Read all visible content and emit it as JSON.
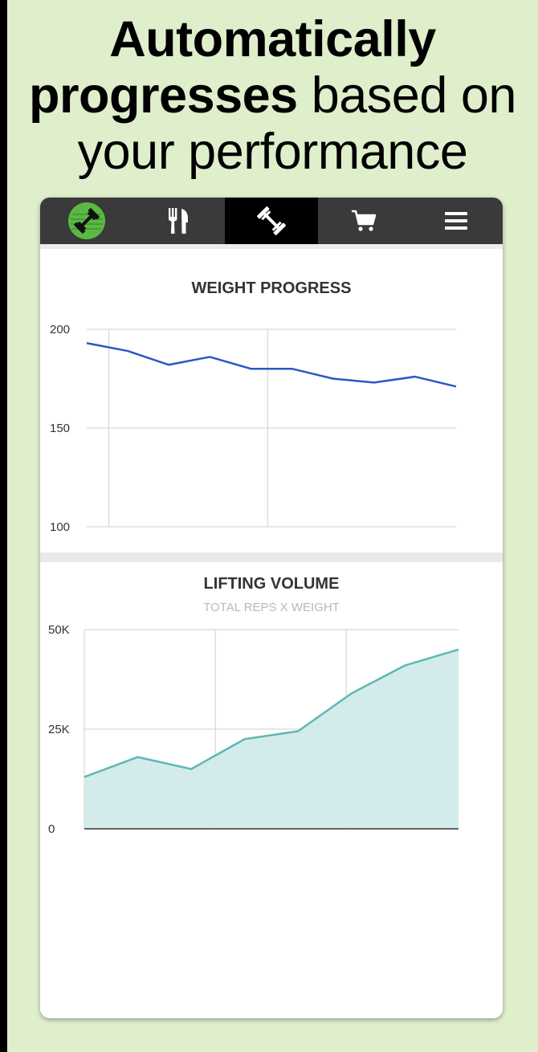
{
  "headline": {
    "line1_bold": "Automatically",
    "line2_bold": "progresses",
    "line2_regular": " based on",
    "line3_regular": "your performance"
  },
  "nav": {
    "items": [
      {
        "icon": "app-logo-icon",
        "active": false
      },
      {
        "icon": "fork-knife-icon",
        "active": false
      },
      {
        "icon": "dumbbell-icon",
        "active": true
      },
      {
        "icon": "cart-icon",
        "active": false
      },
      {
        "icon": "menu-icon",
        "active": false
      }
    ]
  },
  "colors": {
    "page_background": "#dfeecb",
    "nav_background": "#3a3a3a",
    "nav_active": "#000000",
    "logo_green": "#5cb844",
    "weight_line": "#2a58c7",
    "volume_line": "#5fb7b5",
    "volume_fill": "#d1ebea"
  },
  "chart_data": [
    {
      "type": "line",
      "title": "WEIGHT PROGRESS",
      "subtitle": "",
      "xlabel": "",
      "ylabel": "",
      "ylim": [
        100,
        200
      ],
      "yticks": [
        "200",
        "150",
        "100"
      ],
      "grid": true,
      "x": [
        0,
        1,
        2,
        3,
        4,
        5,
        6,
        7,
        8,
        9
      ],
      "series": [
        {
          "values": [
            193,
            189,
            182,
            186,
            180,
            180,
            175,
            173,
            176,
            171
          ]
        }
      ]
    },
    {
      "type": "area",
      "title": "LIFTING VOLUME",
      "subtitle": "TOTAL REPS X WEIGHT",
      "xlabel": "",
      "ylabel": "",
      "ylim": [
        0,
        50000
      ],
      "yticks": [
        "50K",
        "25K",
        "0"
      ],
      "grid": true,
      "x": [
        0,
        1,
        2,
        3,
        4,
        5,
        6,
        7
      ],
      "series": [
        {
          "values": [
            13000,
            18000,
            15000,
            22500,
            24500,
            34000,
            41000,
            45000
          ]
        }
      ]
    }
  ]
}
